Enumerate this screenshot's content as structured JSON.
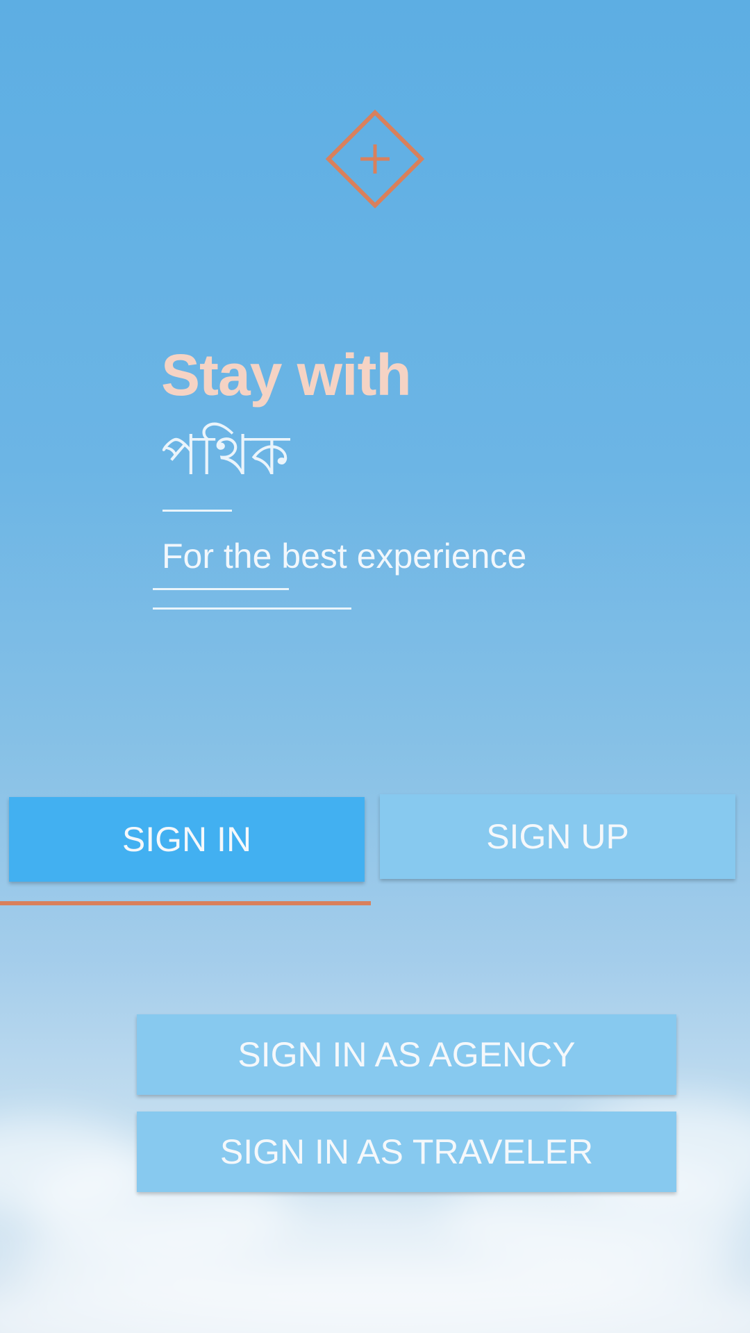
{
  "app": {
    "logo_icon": "diamond-plus-icon",
    "accent_color": "#d9805c"
  },
  "hero": {
    "headline": "Stay with",
    "brand": "পথিক",
    "tagline": "For the best experience"
  },
  "auth_tabs": {
    "sign_in_label": "SIGN IN",
    "sign_up_label": "SIGN UP",
    "active_tab": "SIGN IN"
  },
  "sign_in_options": {
    "agency_label": "SIGN IN AS AGENCY",
    "traveler_label": "SIGN IN AS TRAVELER"
  }
}
